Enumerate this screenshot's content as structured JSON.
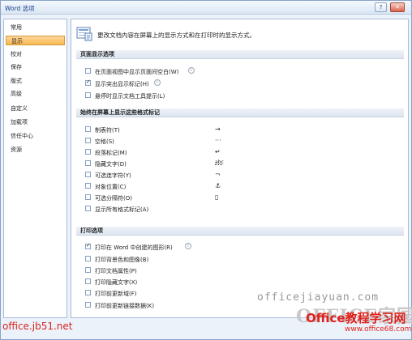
{
  "window": {
    "title": "Word 选项",
    "help_glyph": "?",
    "close_glyph": "✕"
  },
  "nav": {
    "items": [
      {
        "label": "常用"
      },
      {
        "label": "显示"
      },
      {
        "label": "校对"
      },
      {
        "label": "保存"
      },
      {
        "label": "版式"
      },
      {
        "label": "高级"
      },
      {
        "label": "自定义"
      },
      {
        "label": "加载项"
      },
      {
        "label": "信任中心"
      },
      {
        "label": "资源"
      }
    ],
    "active_index": 1
  },
  "header": {
    "text": "更改文档内容在屏幕上的显示方式和在打印时的显示方式。",
    "icon": "display-settings-icon"
  },
  "sections": [
    {
      "title": "页面显示选项"
    },
    {
      "title": "始终在屏幕上显示这些格式标记"
    },
    {
      "title": "打印选项"
    }
  ],
  "page_display_options": [
    {
      "label": "在页面视图中显示页面间空白(W)",
      "checked": false,
      "info": true
    },
    {
      "label": "显示突出显示标记(H)",
      "checked": true,
      "info": true
    },
    {
      "label": "悬停时显示文档工具提示(L)",
      "checked": false,
      "info": false
    }
  ],
  "formatting_marks": [
    {
      "label": "制表符(T)",
      "checked": false,
      "symbol": "→"
    },
    {
      "label": "空格(S)",
      "checked": false,
      "symbol": "···"
    },
    {
      "label": "段落标记(M)",
      "checked": false,
      "symbol": "↵"
    },
    {
      "label": "隐藏文字(D)",
      "checked": false,
      "symbol": "abc"
    },
    {
      "label": "可选连字符(Y)",
      "checked": false,
      "symbol": "¬"
    },
    {
      "label": "对象位置(C)",
      "checked": false,
      "symbol": "⚓"
    },
    {
      "label": "可选分隔符(O)",
      "checked": false,
      "symbol": "▯"
    },
    {
      "label": "显示所有格式标记(A)",
      "checked": false,
      "symbol": ""
    }
  ],
  "print_options": [
    {
      "label": "打印在 Word 中创建的图形(R)",
      "checked": true,
      "info": true
    },
    {
      "label": "打印背景色和图像(B)",
      "checked": false,
      "info": false
    },
    {
      "label": "打印文档属性(P)",
      "checked": false,
      "info": false
    },
    {
      "label": "打印隐藏文字(X)",
      "checked": false,
      "info": false
    },
    {
      "label": "打印前更新域(F)",
      "checked": false,
      "info": false
    },
    {
      "label": "打印前更新链接数据(K)",
      "checked": false,
      "info": false
    }
  ],
  "watermarks": {
    "url1": "officejiayuan.com",
    "logo": "OFFICE家园",
    "brand": "Office教程学习网",
    "url2": "www.office68.com",
    "jb51": "office.jb51.net"
  }
}
